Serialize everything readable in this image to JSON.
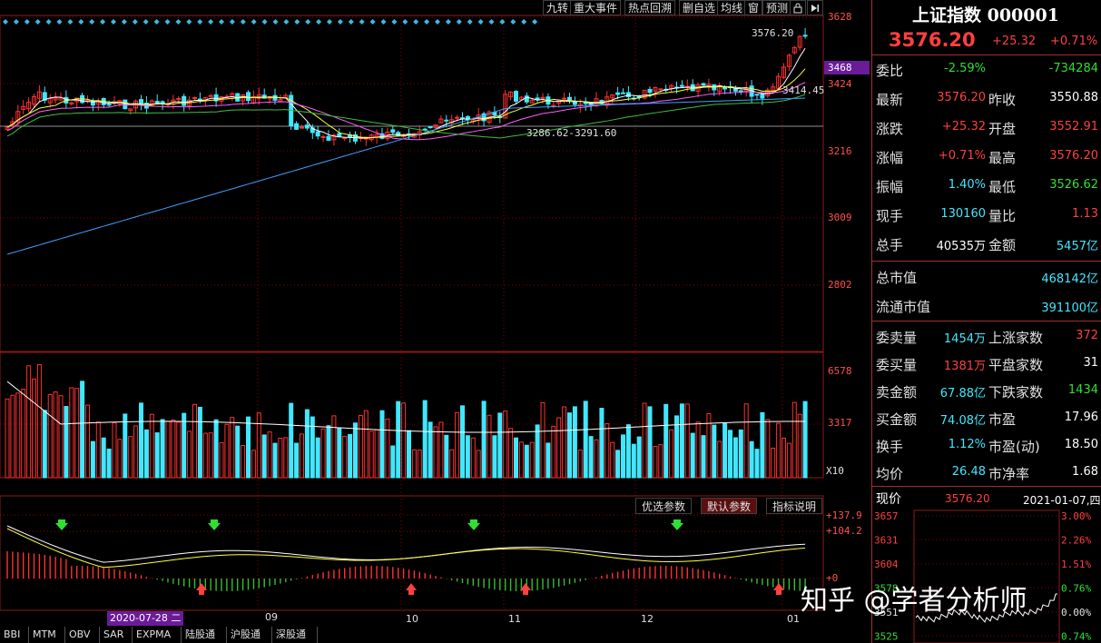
{
  "toolbar": {
    "buttons": [
      "九转",
      "重大事件",
      "热点回溯",
      "删自选",
      "均线",
      "窗",
      "预测"
    ],
    "lock_icon": "lock-icon",
    "next_icon": "skip-forward-icon"
  },
  "price_axis": {
    "labels": [
      "3628",
      "3468",
      "3424",
      "3216",
      "3009",
      "2802"
    ],
    "current_marker": "3468"
  },
  "price_annotations": {
    "high_label": "3576.20",
    "low_label": "3286.62-3291.60",
    "ma_label": "3414.45"
  },
  "volume_axis": {
    "labels": [
      "6578",
      "3317",
      "X10"
    ]
  },
  "indicator": {
    "axis_labels": [
      "+137.9",
      "+104.2",
      "+0"
    ],
    "buttons": [
      "优选参数",
      "默认参数",
      "指标说明"
    ],
    "active_button": "默认参数"
  },
  "date_axis": {
    "selected": "2020-07-28 二",
    "months": [
      "09",
      "10",
      "11",
      "12",
      "01"
    ]
  },
  "bottom_tabs": [
    "BBI",
    "MTM",
    "OBV",
    "SAR",
    "EXPMA",
    "陆股通",
    "沪股通",
    "深股通"
  ],
  "quote": {
    "title": "上证指数 000001",
    "price": "3576.20",
    "change": "+25.32",
    "change_pct": "+0.71%",
    "rows": [
      {
        "l1": "委比",
        "v1": "-2.59%",
        "c1": "green",
        "l2": "",
        "v2": "-734284",
        "c2": "green"
      },
      {
        "l1": "最新",
        "v1": "3576.20",
        "c1": "red",
        "l2": "昨收",
        "v2": "3550.88",
        "c2": "white"
      },
      {
        "l1": "涨跌",
        "v1": "+25.32",
        "c1": "red",
        "l2": "开盘",
        "v2": "3552.91",
        "c2": "red"
      },
      {
        "l1": "涨幅",
        "v1": "+0.71%",
        "c1": "red",
        "l2": "最高",
        "v2": "3576.20",
        "c2": "red"
      },
      {
        "l1": "振幅",
        "v1": "1.40%",
        "c1": "cyan",
        "l2": "最低",
        "v2": "3526.62",
        "c2": "green"
      },
      {
        "l1": "现手",
        "v1": "130160",
        "c1": "cyan",
        "l2": "量比",
        "v2": "1.13",
        "c2": "red"
      },
      {
        "l1": "总手",
        "v1": "40535万",
        "c1": "white",
        "l2": "金额",
        "v2": "5457亿",
        "c2": "cyan"
      }
    ],
    "market_value": {
      "label": "总市值",
      "value": "468142亿"
    },
    "float_value": {
      "label": "流通市值",
      "value": "391100亿"
    },
    "rows2": [
      {
        "l1": "委卖量",
        "v1": "1454万",
        "c1": "cyan",
        "l2": "上涨家数",
        "v2": "372",
        "c2": "red"
      },
      {
        "l1": "委买量",
        "v1": "1381万",
        "c1": "red",
        "l2": "平盘家数",
        "v2": "31",
        "c2": "white"
      },
      {
        "l1": "卖金额",
        "v1": "67.88亿",
        "c1": "cyan",
        "l2": "下跌家数",
        "v2": "1434",
        "c2": "green"
      },
      {
        "l1": "买金额",
        "v1": "74.08亿",
        "c1": "cyan",
        "l2": "市盈",
        "v2": "17.96",
        "c2": "white"
      },
      {
        "l1": "换手",
        "v1": "1.12%",
        "c1": "cyan",
        "l2": "市盈(动)",
        "v2": "18.50",
        "c2": "white"
      },
      {
        "l1": "均价",
        "v1": "26.48",
        "c1": "cyan",
        "l2": "市净率",
        "v2": "1.68",
        "c2": "white"
      }
    ],
    "mini": {
      "label": "现价",
      "price": "3576.20",
      "date": "2021-01-07,四",
      "left_axis": [
        "3657",
        "3631",
        "3604",
        "3578",
        "3551",
        "3525"
      ],
      "right_axis": [
        "3.00%",
        "2.26%",
        "1.51%",
        "0.76%",
        "0.00%",
        "0.74%"
      ]
    }
  },
  "watermark": "知乎 @学者分析师",
  "colors": {
    "up": "#ff3030",
    "down": "#40e8ff",
    "grid": "#8b0000",
    "accent": "#6a1b9a"
  }
}
